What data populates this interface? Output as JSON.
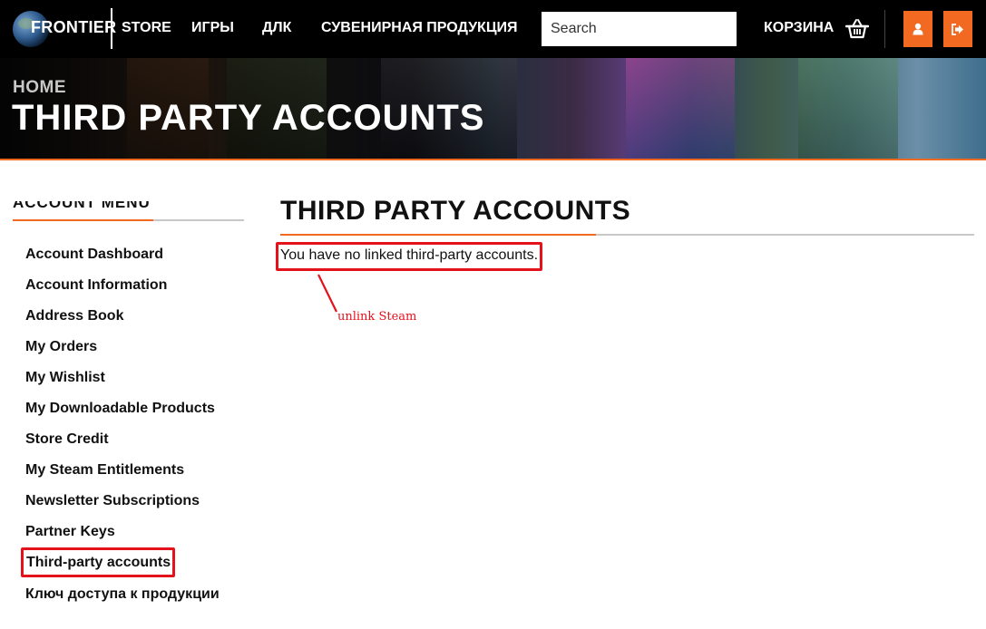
{
  "nav": {
    "logo_text": "FRONTIER",
    "items": [
      "STORE",
      "ИГРЫ",
      "ДЛК",
      "СУВЕНИРНАЯ ПРОДУКЦИЯ"
    ],
    "search_placeholder": "Search",
    "cart_label": "КОРЗИНА",
    "accent_color": "#f26a21"
  },
  "banner": {
    "breadcrumb": "HOME",
    "title": "THIRD PARTY ACCOUNTS"
  },
  "sidebar": {
    "heading": "ACCOUNT MENU",
    "items": [
      {
        "label": "Account Dashboard"
      },
      {
        "label": "Account Information"
      },
      {
        "label": "Address Book"
      },
      {
        "label": "My Orders"
      },
      {
        "label": "My Wishlist"
      },
      {
        "label": "My Downloadable Products"
      },
      {
        "label": "Store Credit"
      },
      {
        "label": "My Steam Entitlements"
      },
      {
        "label": "Newsletter Subscriptions"
      },
      {
        "label": "Partner Keys"
      },
      {
        "label": "Third-party accounts",
        "highlighted": true
      },
      {
        "label": "Ключ доступа к продукции"
      }
    ]
  },
  "main": {
    "title": "THIRD PARTY ACCOUNTS",
    "message": "You have no linked third-party accounts."
  },
  "annotation": {
    "note": "unlink Steam",
    "color": "#e3121b"
  }
}
